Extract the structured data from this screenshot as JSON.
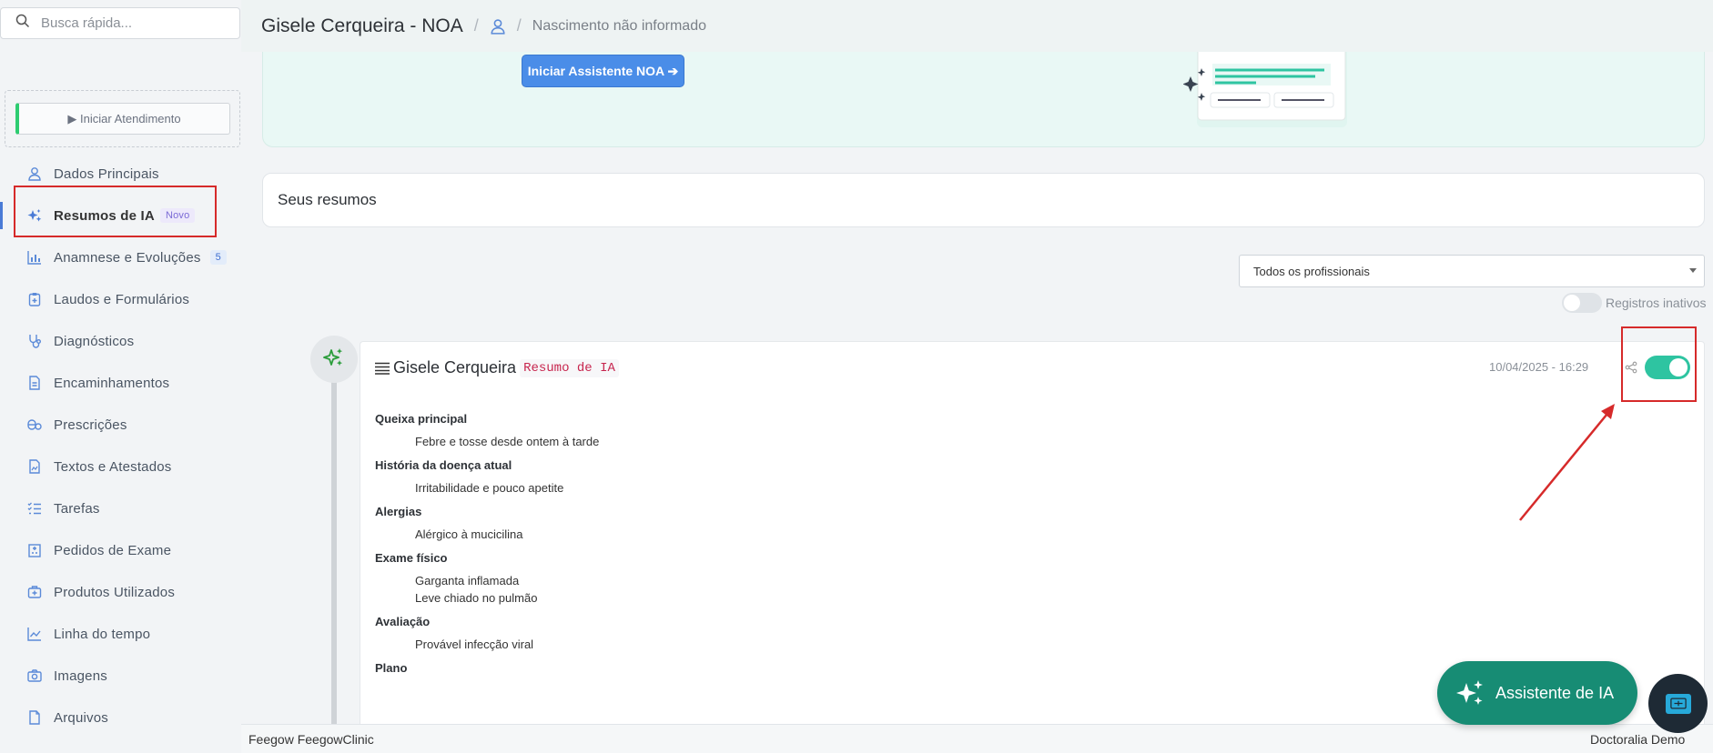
{
  "search": {
    "placeholder": "Busca rápida..."
  },
  "sidebar": {
    "start_label": "▶ Iniciar Atendimento",
    "items": [
      {
        "label": "Dados Principais",
        "icon": "user-icon"
      },
      {
        "label": "Resumos de IA",
        "icon": "sparkle-icon",
        "badge": "Novo",
        "active": true
      },
      {
        "label": "Anamnese e Evoluções",
        "icon": "bar-chart-icon",
        "count": "5"
      },
      {
        "label": "Laudos e Formulários",
        "icon": "clipboard-icon"
      },
      {
        "label": "Diagnósticos",
        "icon": "stethoscope-icon"
      },
      {
        "label": "Encaminhamentos",
        "icon": "file-icon"
      },
      {
        "label": "Prescrições",
        "icon": "pills-icon"
      },
      {
        "label": "Textos e Atestados",
        "icon": "document-icon"
      },
      {
        "label": "Tarefas",
        "icon": "tasks-icon"
      },
      {
        "label": "Pedidos de Exame",
        "icon": "hospital-icon"
      },
      {
        "label": "Produtos Utilizados",
        "icon": "medkit-icon"
      },
      {
        "label": "Linha do tempo",
        "icon": "line-chart-icon"
      },
      {
        "label": "Imagens",
        "icon": "camera-icon"
      },
      {
        "label": "Arquivos",
        "icon": "file-blank-icon"
      }
    ]
  },
  "header": {
    "patient_title": "Gisele Cerqueira - NOA",
    "separator": "/",
    "birth": "Nascimento não informado"
  },
  "hero": {
    "noa_button": "Iniciar Assistente NOA ➔"
  },
  "summaries": {
    "title": "Seus resumos",
    "professional_filter": "Todos os profissionais",
    "inactive_label": "Registros inativos"
  },
  "record": {
    "name": "Gisele Cerqueira",
    "tag": "Resumo de IA",
    "datetime": "10/04/2025 - 16:29",
    "sections": [
      {
        "title": "Queixa principal",
        "lines": [
          "Febre e tosse desde ontem à tarde"
        ]
      },
      {
        "title": "História da doença atual",
        "lines": [
          "Irritabilidade e pouco apetite"
        ]
      },
      {
        "title": "Alergias",
        "lines": [
          "Alérgico à mucicilina"
        ]
      },
      {
        "title": "Exame físico",
        "lines": [
          "Garganta inflamada",
          "Leve chiado no pulmão"
        ]
      },
      {
        "title": "Avaliação",
        "lines": [
          "Provável infecção viral"
        ]
      },
      {
        "title": "Plano",
        "lines": []
      }
    ]
  },
  "footer": {
    "left": "Feegow FeegowClinic",
    "right": "Doctoralia Demo"
  },
  "assistant": {
    "label": "Assistente de IA"
  },
  "colors": {
    "accent_green": "#2ec4a1",
    "assistant_green": "#178c74",
    "highlight_red": "#d62a2a",
    "primary_blue": "#4a8de8"
  }
}
